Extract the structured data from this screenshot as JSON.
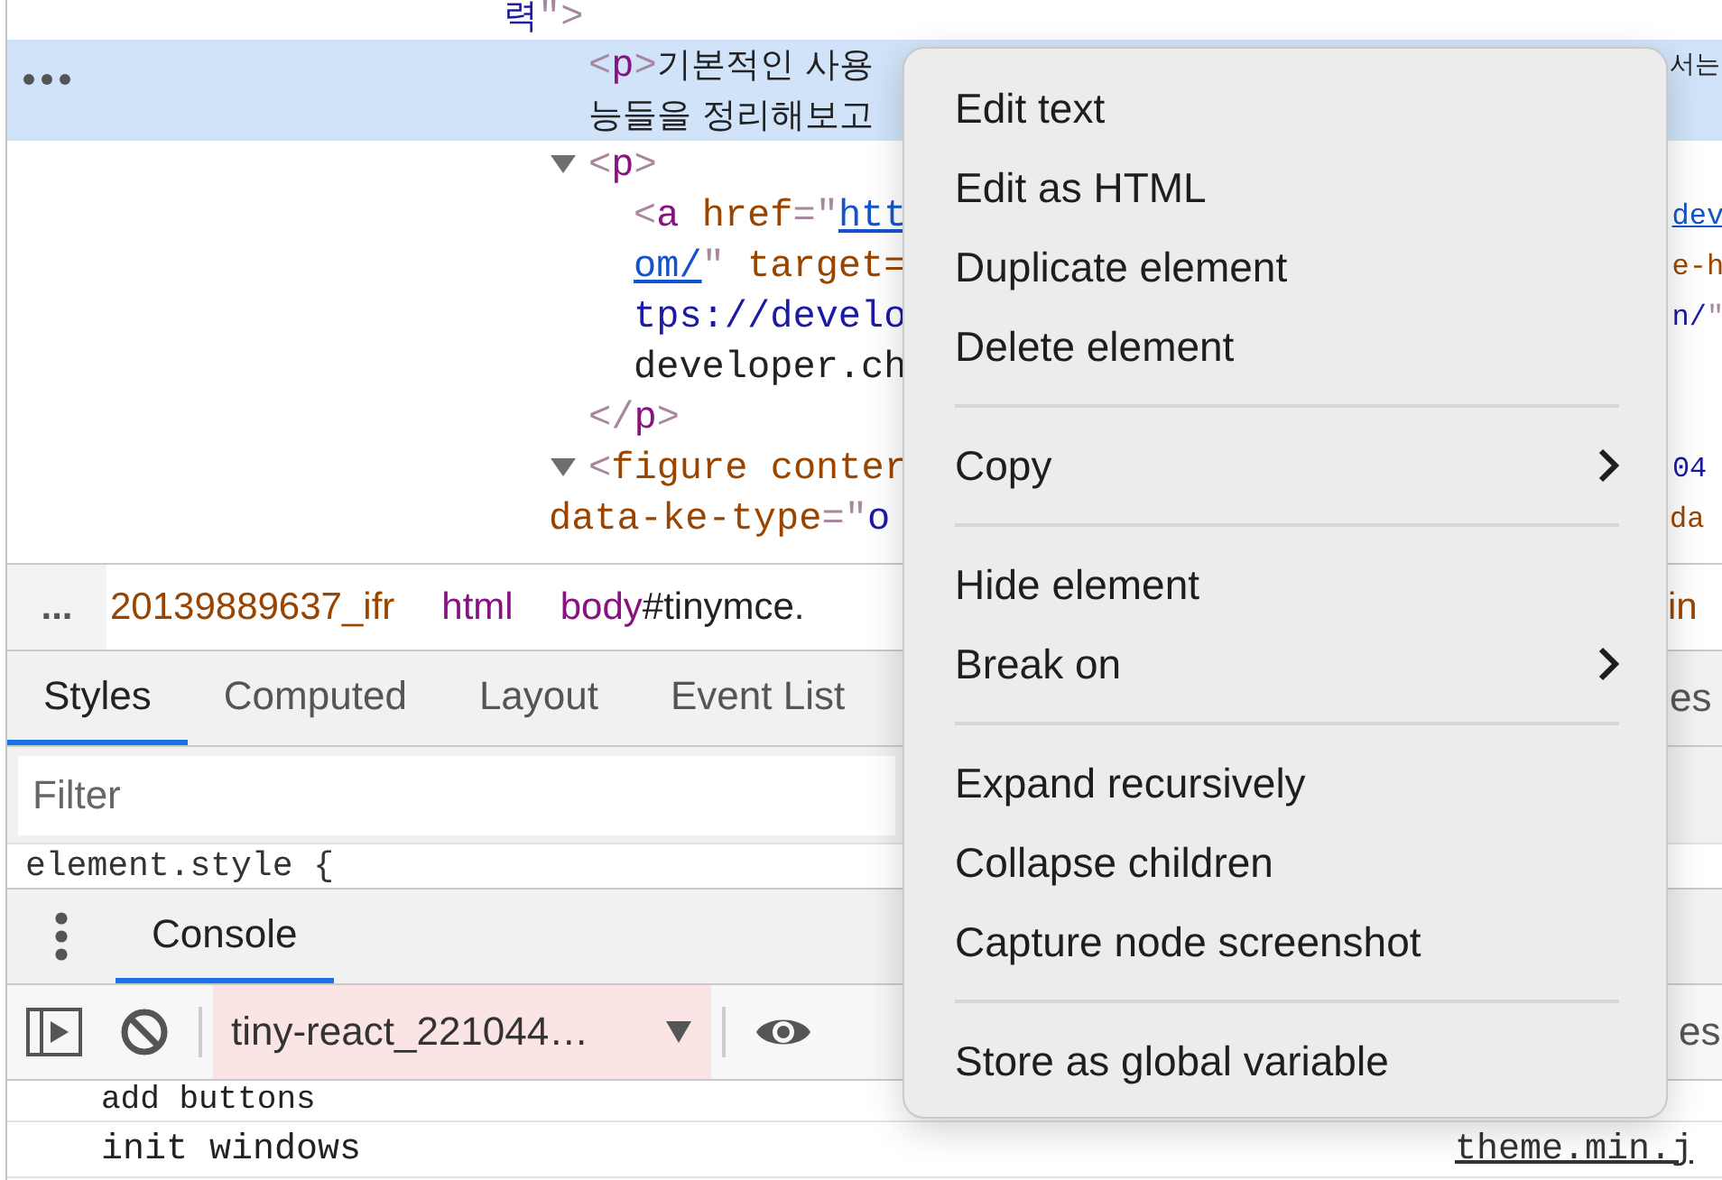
{
  "dom_tree": [
    {
      "lines": [
        {
          "tokens": [
            {
              "kind": "value",
              "t": "력"
            },
            {
              "kind": "punct",
              "t": "\">"
            }
          ]
        }
      ],
      "children": [
        {
          "selected": true,
          "lines": [
            {
              "tokens": [
                {
                  "kind": "punct",
                  "t": "<"
                },
                {
                  "kind": "tag",
                  "t": "p"
                },
                {
                  "kind": "punct",
                  "t": ">"
                },
                {
                  "kind": "text",
                  "t": "기본적인 사용"
                }
              ],
              "tail": [
                {
                  "kind": "text",
                  "t": "서는"
                }
              ]
            },
            {
              "tokens": [
                {
                  "kind": "text",
                  "t": "능들을 정리해보고"
                }
              ]
            }
          ]
        },
        {
          "expanded": true,
          "lines": [
            {
              "tokens": [
                {
                  "kind": "punct",
                  "t": "<"
                },
                {
                  "kind": "tag",
                  "t": "p"
                },
                {
                  "kind": "punct",
                  "t": ">"
                }
              ]
            }
          ],
          "children": [
            {
              "lines": [
                {
                  "tokens": [
                    {
                      "kind": "punct",
                      "t": "<"
                    },
                    {
                      "kind": "tag",
                      "t": "a"
                    },
                    {
                      "kind": "attr",
                      "t": " href"
                    },
                    {
                      "kind": "punct",
                      "t": "=\""
                    },
                    {
                      "kind": "link",
                      "t": "htt"
                    }
                  ],
                  "tail": [
                    {
                      "kind": "link",
                      "t": "dev"
                    }
                  ]
                },
                {
                  "tokens": [
                    {
                      "kind": "link",
                      "t": "om/"
                    },
                    {
                      "kind": "punct",
                      "t": "\""
                    },
                    {
                      "kind": "attr",
                      "t": " target="
                    }
                  ],
                  "tail": [
                    {
                      "kind": "attr",
                      "t": "e-h"
                    }
                  ]
                },
                {
                  "tokens": [
                    {
                      "kind": "value",
                      "t": "tps://develo"
                    }
                  ],
                  "tail": [
                    {
                      "kind": "value",
                      "t": "n/"
                    },
                    {
                      "kind": "punct",
                      "t": "\""
                    }
                  ]
                },
                {
                  "tokens": [
                    {
                      "kind": "text",
                      "t": "developer.ch"
                    }
                  ]
                }
              ]
            }
          ],
          "closing": [
            {
              "kind": "punct",
              "t": "</"
            },
            {
              "kind": "tag",
              "t": "p"
            },
            {
              "kind": "punct",
              "t": ">"
            }
          ]
        },
        {
          "expanded": true,
          "lines": [
            {
              "tokens": [
                {
                  "kind": "punct",
                  "t": "<"
                },
                {
                  "kind": "attr",
                  "t": "figure"
                },
                {
                  "kind": "attr",
                  "t": " conter"
                }
              ],
              "tail": [
                {
                  "kind": "value",
                  "t": "04"
                }
              ]
            },
            {
              "tokens": [
                {
                  "kind": "attr",
                  "t": "data-ke-type"
                },
                {
                  "kind": "punct",
                  "t": "=\""
                },
                {
                  "kind": "value",
                  "t": "o"
                }
              ],
              "tail": [
                {
                  "kind": "attr",
                  "t": "da"
                }
              ]
            }
          ]
        }
      ]
    }
  ],
  "breadcrumbs": {
    "more": "...",
    "crumbs": [
      {
        "parts": [
          {
            "kind": "id",
            "t": "20139889637_ifr"
          }
        ]
      },
      {
        "parts": [
          {
            "kind": "tag",
            "t": "html"
          }
        ]
      },
      {
        "parts": [
          {
            "kind": "tag",
            "t": "body"
          },
          {
            "kind": "text",
            "t": "#tinymce."
          }
        ]
      }
    ],
    "tail": "in"
  },
  "side_tabs": {
    "tabs": [
      {
        "label": "Styles",
        "selected": true
      },
      {
        "label": "Computed",
        "selected": false
      },
      {
        "label": "Layout",
        "selected": false
      },
      {
        "label": "Event List",
        "selected": false
      }
    ],
    "tail": "es"
  },
  "filter": {
    "placeholder": "Filter"
  },
  "styles_pane": {
    "rule": "element.style {"
  },
  "drawer": {
    "tabs": [
      {
        "label": "Console",
        "selected": true
      }
    ]
  },
  "console_toolbar": {
    "context": "tiny-react_221044…",
    "tail": "es"
  },
  "console_messages": [
    {
      "text": "add buttons"
    },
    {
      "text": "init windows",
      "source": "theme.min.j"
    }
  ],
  "context_menu": {
    "groups": [
      [
        {
          "label": "Edit text",
          "submenu": false
        },
        {
          "label": "Edit as HTML",
          "submenu": false
        },
        {
          "label": "Duplicate element",
          "submenu": false
        },
        {
          "label": "Delete element",
          "submenu": false
        }
      ],
      [
        {
          "label": "Copy",
          "submenu": true
        }
      ],
      [
        {
          "label": "Hide element",
          "submenu": false
        },
        {
          "label": "Break on",
          "submenu": true
        }
      ],
      [
        {
          "label": "Expand recursively",
          "submenu": false
        },
        {
          "label": "Collapse children",
          "submenu": false
        },
        {
          "label": "Capture node screenshot",
          "submenu": false
        }
      ],
      [
        {
          "label": "Store as global variable",
          "submenu": false
        }
      ]
    ]
  }
}
